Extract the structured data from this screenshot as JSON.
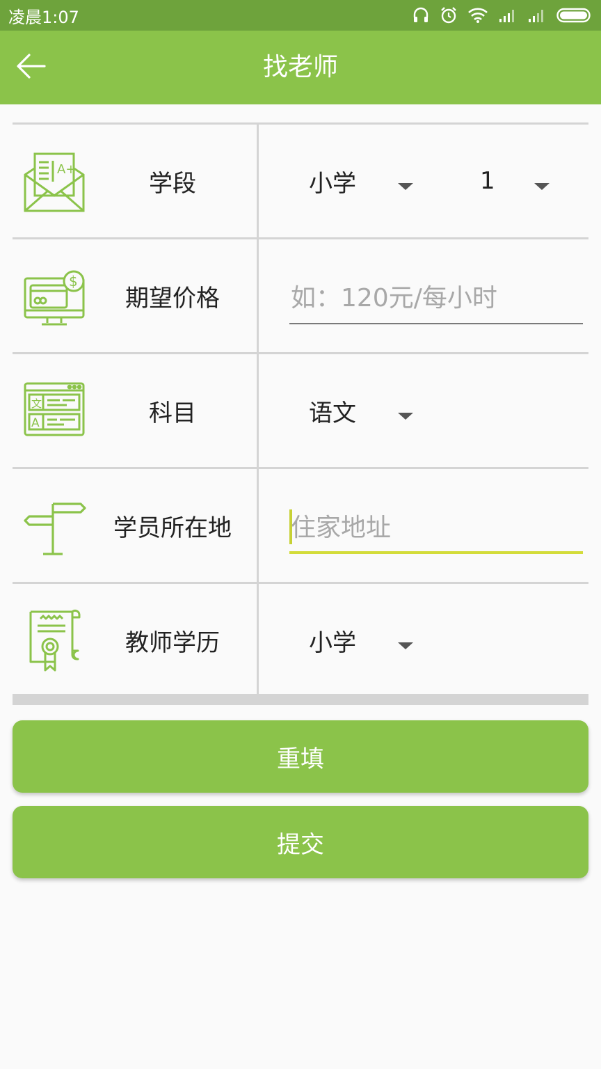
{
  "status_bar": {
    "time": "凌晨1:07",
    "icons": [
      "headset-icon",
      "alarm-icon",
      "wifi-icon",
      "signal-icon",
      "signal-icon-2",
      "battery-icon"
    ]
  },
  "app_bar": {
    "title": "找老师",
    "back_icon": "arrow-left-icon"
  },
  "form": {
    "grade": {
      "label": "学段",
      "icon": "report-card-icon",
      "level_value": "小学",
      "year_value": "1"
    },
    "price": {
      "label": "期望价格",
      "icon": "payment-monitor-icon",
      "placeholder": "如：120元/每小时",
      "value": ""
    },
    "subject": {
      "label": "科目",
      "icon": "translate-window-icon",
      "value": "语文"
    },
    "location": {
      "label": "学员所在地",
      "icon": "signpost-icon",
      "placeholder": "住家地址",
      "value": ""
    },
    "education": {
      "label": "教师学历",
      "icon": "certificate-icon",
      "value": "小学"
    }
  },
  "buttons": {
    "reset_label": "重填",
    "submit_label": "提交"
  },
  "colors": {
    "status_bar": "#6ea33c",
    "primary": "#8bc34a",
    "focus_underline": "#d3dc3a",
    "divider": "#d4d4d4"
  }
}
